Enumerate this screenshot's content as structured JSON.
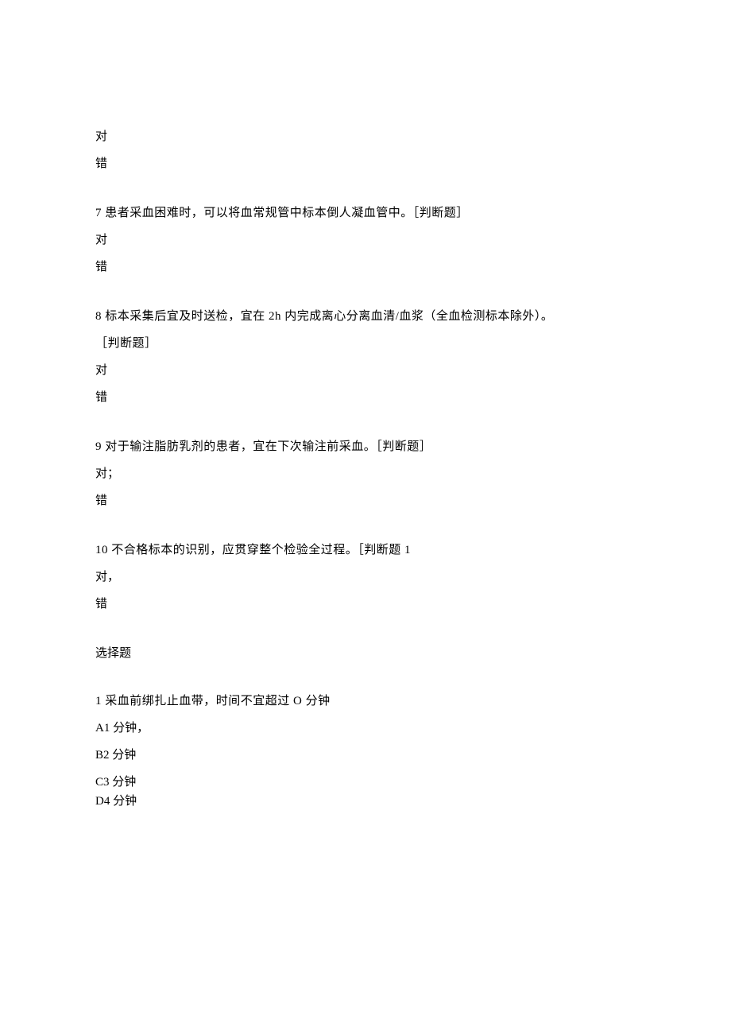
{
  "q6": {
    "opt_true": "对",
    "opt_false": "错"
  },
  "q7": {
    "text": "7 患者采血困难时，可以将血常规管中标本倒人凝血管中。［判断题］",
    "opt_true": "对",
    "opt_false": "错"
  },
  "q8": {
    "text_line1": "8 标本采集后宜及时送检，宜在 2h 内完成离心分离血清/血浆（全血检测标本除外）。",
    "text_line2": "［判断题］",
    "opt_true": "对",
    "opt_false": "错"
  },
  "q9": {
    "text": "9 对于输注脂肪乳剂的患者，宜在下次输注前采血。［判断题］",
    "opt_true": "对；",
    "opt_false": "错"
  },
  "q10": {
    "text": "10 不合格标本的识别，应贯穿整个检验全过程。［判断题 1",
    "opt_true": "对，",
    "opt_false": "错"
  },
  "section": {
    "heading": "选择题"
  },
  "mc1": {
    "text": "1 采血前绑扎止血带，时间不宜超过 O 分钟",
    "optA": "A1 分钟，",
    "optB": "B2 分钟",
    "optC": "C3 分钟",
    "optD": "D4 分钟"
  }
}
